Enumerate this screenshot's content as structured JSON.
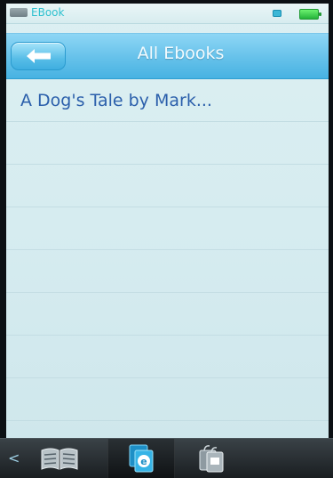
{
  "status_bar": {
    "app_title": "EBook",
    "icons": [
      "app-icon",
      "message-icon",
      "battery-icon"
    ],
    "colors": {
      "title": "#2fc1cf",
      "battery": "#2fbf44"
    }
  },
  "header": {
    "back_icon": "back-arrow-icon",
    "title": "All Ebooks",
    "colors": {
      "bar": "#5bbbe8",
      "title_text": "#f2fbff"
    }
  },
  "list": {
    "items": [
      {
        "label": "A Dog's Tale by Mark..."
      },
      {
        "label": ""
      },
      {
        "label": ""
      },
      {
        "label": ""
      },
      {
        "label": ""
      },
      {
        "label": ""
      },
      {
        "label": ""
      },
      {
        "label": ""
      }
    ],
    "colors": {
      "text": "#2b5fab"
    }
  },
  "bottom_bar": {
    "left_arrow": "<",
    "tabs": [
      {
        "icon": "open-book-icon",
        "active": false
      },
      {
        "icon": "ebook-icon",
        "active": true
      },
      {
        "icon": "bookmark-icon",
        "active": false
      }
    ]
  }
}
